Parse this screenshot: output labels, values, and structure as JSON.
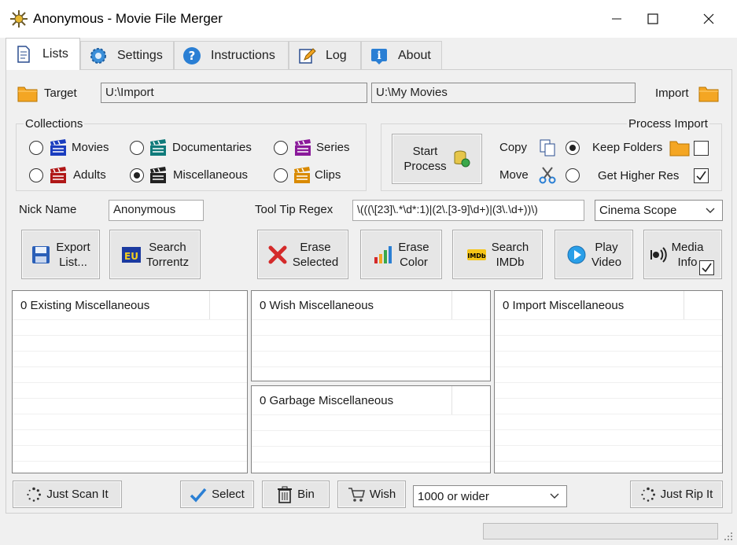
{
  "window": {
    "title": "Anonymous - Movie File Merger",
    "minimize": "—",
    "maximize": "☐",
    "close": "✕"
  },
  "tabs": [
    {
      "label": "Lists",
      "icon": "document-icon"
    },
    {
      "label": "Settings",
      "icon": "gear-icon"
    },
    {
      "label": "Instructions",
      "icon": "help-icon"
    },
    {
      "label": "Log",
      "icon": "pencil-icon"
    },
    {
      "label": "About",
      "icon": "info-icon"
    }
  ],
  "paths": {
    "target_label": "Target",
    "target_value": "U:\\Import",
    "movies_value": "U:\\My Movies",
    "import_label": "Import"
  },
  "collections": {
    "title": "Collections",
    "items": [
      {
        "label": "Movies",
        "selected": false,
        "color": "#1a3dbf"
      },
      {
        "label": "Documentaries",
        "selected": false,
        "color": "#0f7a7a"
      },
      {
        "label": "Series",
        "selected": false,
        "color": "#8a1a9a"
      },
      {
        "label": "Adults",
        "selected": false,
        "color": "#b01818"
      },
      {
        "label": "Miscellaneous",
        "selected": true,
        "color": "#222222"
      },
      {
        "label": "Clips",
        "selected": false,
        "color": "#d98a00"
      }
    ]
  },
  "process": {
    "title": "Process Import",
    "start_line1": "Start",
    "start_line2": "Process",
    "copy_label": "Copy",
    "move_label": "Move",
    "copy_selected": true,
    "keep_folders_label": "Keep Folders",
    "keep_folders_checked": false,
    "higher_res_label": "Get Higher Res",
    "higher_res_checked": true
  },
  "nick": {
    "label": "Nick Name",
    "value": "Anonymous"
  },
  "regex": {
    "label": "Tool Tip Regex",
    "value": "\\(((\\[23]\\.*\\d*:1)|(2\\.[3-9]\\d+)|(3\\.\\d+))\\)"
  },
  "aspect": {
    "value": "Cinema Scope"
  },
  "toolbar": {
    "export": [
      "Export",
      "List..."
    ],
    "search_torrentz": [
      "Search",
      "Torrentz"
    ],
    "erase_selected": [
      "Erase",
      "Selected"
    ],
    "erase_color": [
      "Erase",
      "Color"
    ],
    "search_imdb": [
      "Search",
      "IMDb"
    ],
    "play_video": [
      "Play",
      "Video"
    ],
    "media_info": [
      "Media",
      "Info"
    ],
    "media_info_checked": true,
    "imdb_badge": "IMDb",
    "eu_badge": "EU"
  },
  "lists": {
    "existing": "0 Existing Miscellaneous",
    "wish": "0 Wish Miscellaneous",
    "garbage": "0 Garbage Miscellaneous",
    "import": "0 Import Miscellaneous"
  },
  "bottom": {
    "just_scan": "Just Scan It",
    "select": "Select",
    "bin": "Bin",
    "wish": "Wish",
    "size_filter": "1000 or wider",
    "just_rip": "Just Rip It"
  },
  "colors": {
    "folder": "#f4a623",
    "accent_blue": "#2a7fd4",
    "erase_red": "#d42a2a"
  }
}
